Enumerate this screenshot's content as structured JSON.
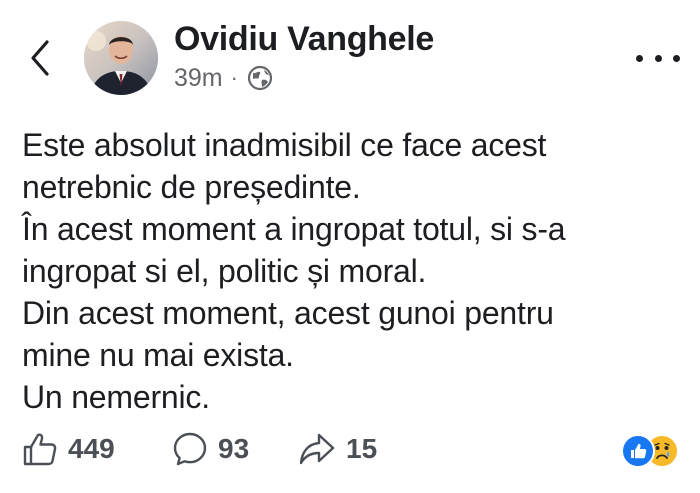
{
  "post": {
    "author": "Ovidiu Vanghele",
    "time": "39m",
    "separator": "·",
    "audience_icon": "globe-icon",
    "body_lines": [
      "Este absolut inadmisibil ce face acest",
      "netrebnic de președinte.",
      "În acest moment a ingropat totul, si s-a",
      "ingropat si el, politic și moral.",
      "Din acest moment, acest gunoi pentru",
      "mine nu mai exista.",
      "Un nemernic."
    ]
  },
  "actions": {
    "likes": "449",
    "comments": "93",
    "shares": "15"
  },
  "reactions": [
    "like-icon",
    "sad-face-icon"
  ],
  "colors": {
    "text": "#1c1e21",
    "secondary": "#65676b",
    "like_blue": "#1877f2",
    "sad_yellow": "#f7b928"
  }
}
